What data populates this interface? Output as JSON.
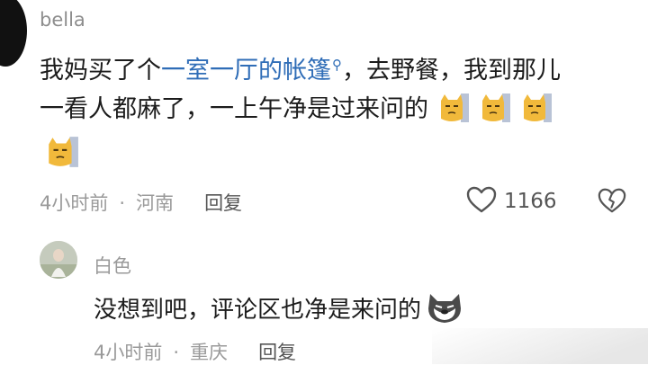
{
  "comment": {
    "username": "bella",
    "text_line1_before": "我妈买了个",
    "text_link": "一室一厅的帐篷",
    "text_line1_after": "，去野餐，我到那儿",
    "text_line2": "一看人都麻了，一上午净是过来问的",
    "time": "4小时前",
    "location": "河南",
    "reply_label": "回复",
    "likes": "1166",
    "emoji_name": "cat-facepalm-emoji",
    "emoji_count": 4
  },
  "reply": {
    "username": "白色",
    "text": "没想到吧，评论区也净是来问的",
    "time": "4小时前",
    "location": "重庆",
    "reply_label": "回复"
  },
  "colors": {
    "link": "#2f6db7",
    "meta_gray": "#9a9a9a",
    "emoji_yellow": "#f1b93b"
  }
}
